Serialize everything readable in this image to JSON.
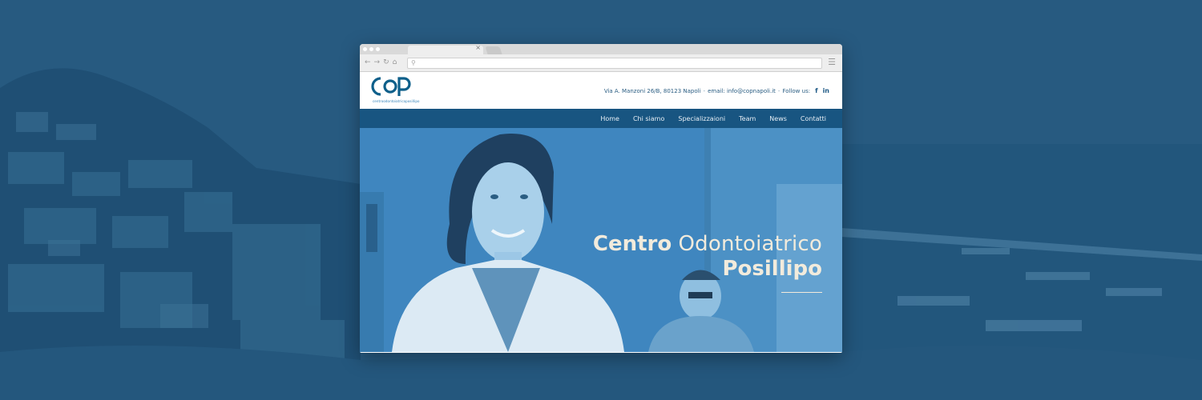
{
  "header": {
    "logo_text": "COP",
    "logo_subtitle": "centroodontoiatricoposillipo",
    "address": "Via A. Manzoni 26/B, 80123 Napoli",
    "email": "email: info@copnapoli.it",
    "follow_label": "Follow us:",
    "separator": "-",
    "icons": [
      "facebook-icon",
      "linkedin-icon"
    ]
  },
  "browser": {
    "tab_close": "×",
    "nav_icons": [
      "back-icon",
      "forward-icon",
      "reload-icon",
      "home-icon"
    ],
    "url_value": ""
  },
  "nav": {
    "items": [
      "Home",
      "Chi siamo",
      "Specializzaioni",
      "Team",
      "News",
      "Contatti"
    ]
  },
  "hero": {
    "title_bold": "Centro",
    "title_light": "Odontoiatrico",
    "title_line2": "Posillipo"
  },
  "colors": {
    "background": "#2a5d82",
    "navbar": "#185581",
    "hero": "#3f86bf",
    "hero_text": "#f2ebdc"
  }
}
